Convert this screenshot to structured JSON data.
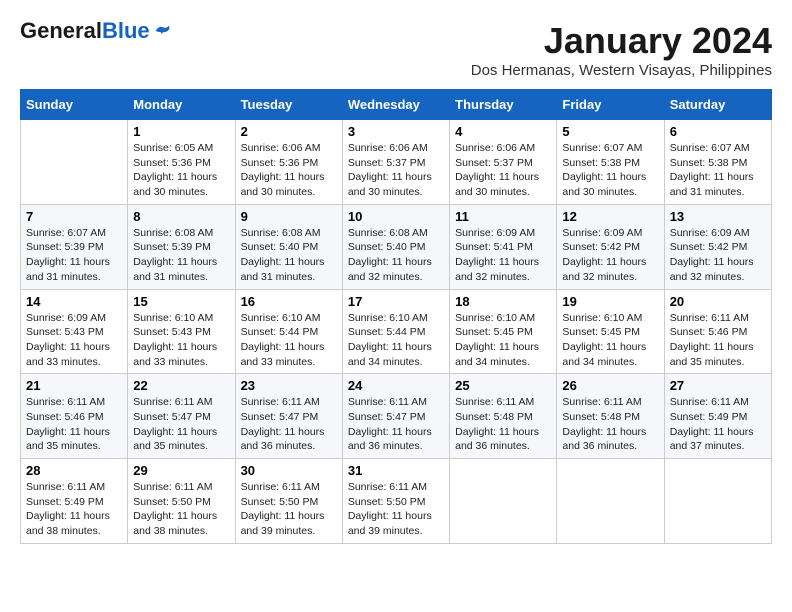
{
  "header": {
    "logo_general": "General",
    "logo_blue": "Blue",
    "month_title": "January 2024",
    "location": "Dos Hermanas, Western Visayas, Philippines"
  },
  "weekdays": [
    "Sunday",
    "Monday",
    "Tuesday",
    "Wednesday",
    "Thursday",
    "Friday",
    "Saturday"
  ],
  "weeks": [
    [
      {
        "day": "",
        "sunrise": "",
        "sunset": "",
        "daylight": ""
      },
      {
        "day": "1",
        "sunrise": "Sunrise: 6:05 AM",
        "sunset": "Sunset: 5:36 PM",
        "daylight": "Daylight: 11 hours and 30 minutes."
      },
      {
        "day": "2",
        "sunrise": "Sunrise: 6:06 AM",
        "sunset": "Sunset: 5:36 PM",
        "daylight": "Daylight: 11 hours and 30 minutes."
      },
      {
        "day": "3",
        "sunrise": "Sunrise: 6:06 AM",
        "sunset": "Sunset: 5:37 PM",
        "daylight": "Daylight: 11 hours and 30 minutes."
      },
      {
        "day": "4",
        "sunrise": "Sunrise: 6:06 AM",
        "sunset": "Sunset: 5:37 PM",
        "daylight": "Daylight: 11 hours and 30 minutes."
      },
      {
        "day": "5",
        "sunrise": "Sunrise: 6:07 AM",
        "sunset": "Sunset: 5:38 PM",
        "daylight": "Daylight: 11 hours and 30 minutes."
      },
      {
        "day": "6",
        "sunrise": "Sunrise: 6:07 AM",
        "sunset": "Sunset: 5:38 PM",
        "daylight": "Daylight: 11 hours and 31 minutes."
      }
    ],
    [
      {
        "day": "7",
        "sunrise": "Sunrise: 6:07 AM",
        "sunset": "Sunset: 5:39 PM",
        "daylight": "Daylight: 11 hours and 31 minutes."
      },
      {
        "day": "8",
        "sunrise": "Sunrise: 6:08 AM",
        "sunset": "Sunset: 5:39 PM",
        "daylight": "Daylight: 11 hours and 31 minutes."
      },
      {
        "day": "9",
        "sunrise": "Sunrise: 6:08 AM",
        "sunset": "Sunset: 5:40 PM",
        "daylight": "Daylight: 11 hours and 31 minutes."
      },
      {
        "day": "10",
        "sunrise": "Sunrise: 6:08 AM",
        "sunset": "Sunset: 5:40 PM",
        "daylight": "Daylight: 11 hours and 32 minutes."
      },
      {
        "day": "11",
        "sunrise": "Sunrise: 6:09 AM",
        "sunset": "Sunset: 5:41 PM",
        "daylight": "Daylight: 11 hours and 32 minutes."
      },
      {
        "day": "12",
        "sunrise": "Sunrise: 6:09 AM",
        "sunset": "Sunset: 5:42 PM",
        "daylight": "Daylight: 11 hours and 32 minutes."
      },
      {
        "day": "13",
        "sunrise": "Sunrise: 6:09 AM",
        "sunset": "Sunset: 5:42 PM",
        "daylight": "Daylight: 11 hours and 32 minutes."
      }
    ],
    [
      {
        "day": "14",
        "sunrise": "Sunrise: 6:09 AM",
        "sunset": "Sunset: 5:43 PM",
        "daylight": "Daylight: 11 hours and 33 minutes."
      },
      {
        "day": "15",
        "sunrise": "Sunrise: 6:10 AM",
        "sunset": "Sunset: 5:43 PM",
        "daylight": "Daylight: 11 hours and 33 minutes."
      },
      {
        "day": "16",
        "sunrise": "Sunrise: 6:10 AM",
        "sunset": "Sunset: 5:44 PM",
        "daylight": "Daylight: 11 hours and 33 minutes."
      },
      {
        "day": "17",
        "sunrise": "Sunrise: 6:10 AM",
        "sunset": "Sunset: 5:44 PM",
        "daylight": "Daylight: 11 hours and 34 minutes."
      },
      {
        "day": "18",
        "sunrise": "Sunrise: 6:10 AM",
        "sunset": "Sunset: 5:45 PM",
        "daylight": "Daylight: 11 hours and 34 minutes."
      },
      {
        "day": "19",
        "sunrise": "Sunrise: 6:10 AM",
        "sunset": "Sunset: 5:45 PM",
        "daylight": "Daylight: 11 hours and 34 minutes."
      },
      {
        "day": "20",
        "sunrise": "Sunrise: 6:11 AM",
        "sunset": "Sunset: 5:46 PM",
        "daylight": "Daylight: 11 hours and 35 minutes."
      }
    ],
    [
      {
        "day": "21",
        "sunrise": "Sunrise: 6:11 AM",
        "sunset": "Sunset: 5:46 PM",
        "daylight": "Daylight: 11 hours and 35 minutes."
      },
      {
        "day": "22",
        "sunrise": "Sunrise: 6:11 AM",
        "sunset": "Sunset: 5:47 PM",
        "daylight": "Daylight: 11 hours and 35 minutes."
      },
      {
        "day": "23",
        "sunrise": "Sunrise: 6:11 AM",
        "sunset": "Sunset: 5:47 PM",
        "daylight": "Daylight: 11 hours and 36 minutes."
      },
      {
        "day": "24",
        "sunrise": "Sunrise: 6:11 AM",
        "sunset": "Sunset: 5:47 PM",
        "daylight": "Daylight: 11 hours and 36 minutes."
      },
      {
        "day": "25",
        "sunrise": "Sunrise: 6:11 AM",
        "sunset": "Sunset: 5:48 PM",
        "daylight": "Daylight: 11 hours and 36 minutes."
      },
      {
        "day": "26",
        "sunrise": "Sunrise: 6:11 AM",
        "sunset": "Sunset: 5:48 PM",
        "daylight": "Daylight: 11 hours and 36 minutes."
      },
      {
        "day": "27",
        "sunrise": "Sunrise: 6:11 AM",
        "sunset": "Sunset: 5:49 PM",
        "daylight": "Daylight: 11 hours and 37 minutes."
      }
    ],
    [
      {
        "day": "28",
        "sunrise": "Sunrise: 6:11 AM",
        "sunset": "Sunset: 5:49 PM",
        "daylight": "Daylight: 11 hours and 38 minutes."
      },
      {
        "day": "29",
        "sunrise": "Sunrise: 6:11 AM",
        "sunset": "Sunset: 5:50 PM",
        "daylight": "Daylight: 11 hours and 38 minutes."
      },
      {
        "day": "30",
        "sunrise": "Sunrise: 6:11 AM",
        "sunset": "Sunset: 5:50 PM",
        "daylight": "Daylight: 11 hours and 39 minutes."
      },
      {
        "day": "31",
        "sunrise": "Sunrise: 6:11 AM",
        "sunset": "Sunset: 5:50 PM",
        "daylight": "Daylight: 11 hours and 39 minutes."
      },
      {
        "day": "",
        "sunrise": "",
        "sunset": "",
        "daylight": ""
      },
      {
        "day": "",
        "sunrise": "",
        "sunset": "",
        "daylight": ""
      },
      {
        "day": "",
        "sunrise": "",
        "sunset": "",
        "daylight": ""
      }
    ]
  ]
}
